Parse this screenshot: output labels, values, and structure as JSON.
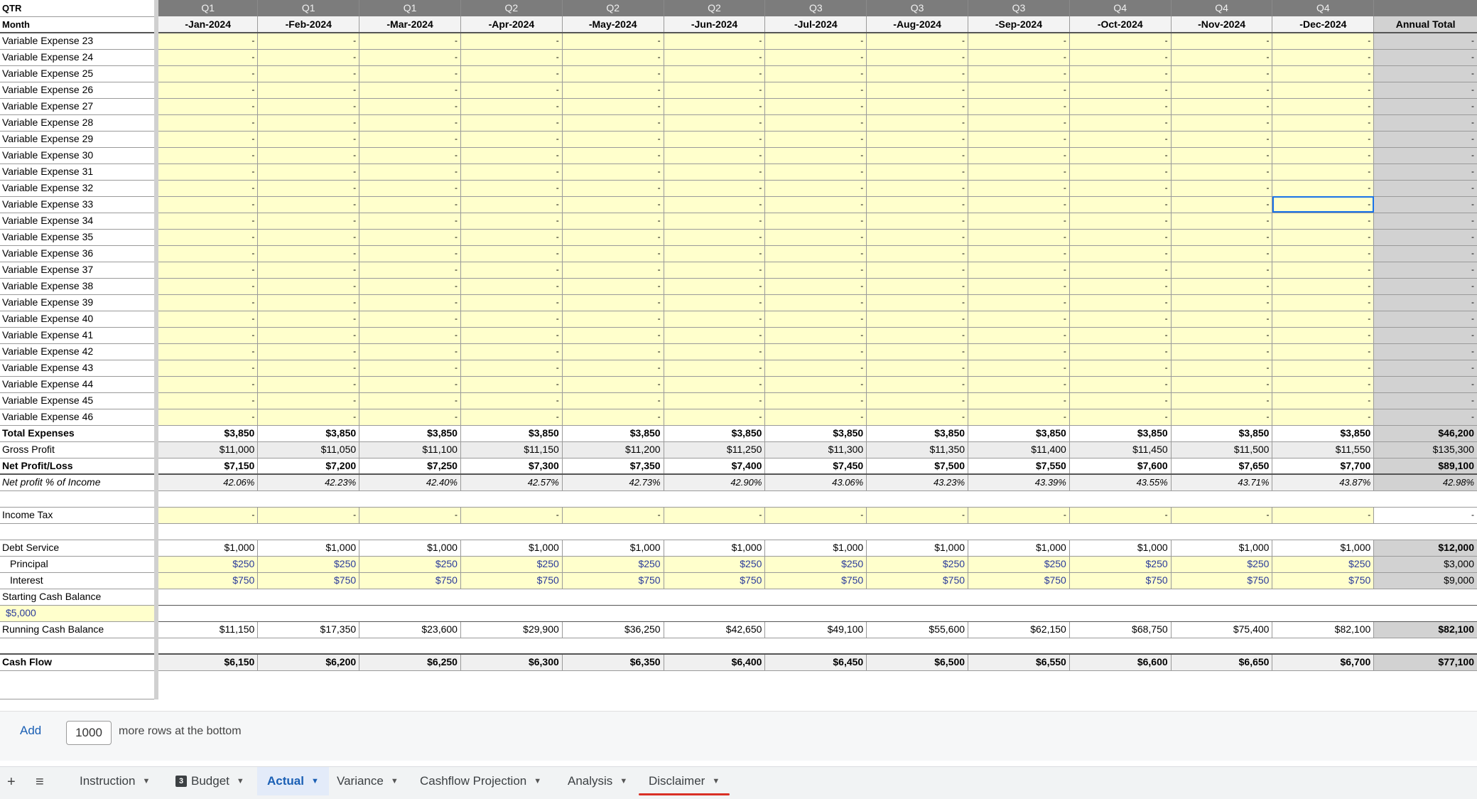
{
  "sheet": {
    "qtr_label": "QTR",
    "month_label": "Month",
    "quarters": [
      "Q1",
      "Q1",
      "Q1",
      "Q2",
      "Q2",
      "Q2",
      "Q3",
      "Q3",
      "Q3",
      "Q4",
      "Q4",
      "Q4"
    ],
    "months": [
      "-Jan-2024",
      "-Feb-2024",
      "-Mar-2024",
      "-Apr-2024",
      "-May-2024",
      "-Jun-2024",
      "-Jul-2024",
      "-Aug-2024",
      "-Sep-2024",
      "-Oct-2024",
      "-Nov-2024",
      "-Dec-2024"
    ],
    "annual_total_label": "Annual Total",
    "empty_value": "-",
    "variable_expenses": [
      "Variable Expense 23",
      "Variable Expense 24",
      "Variable Expense 25",
      "Variable Expense 26",
      "Variable Expense 27",
      "Variable Expense 28",
      "Variable Expense 29",
      "Variable Expense 30",
      "Variable Expense 31",
      "Variable Expense 32",
      "Variable Expense 33",
      "Variable Expense 34",
      "Variable Expense 35",
      "Variable Expense 36",
      "Variable Expense 37",
      "Variable Expense 38",
      "Variable Expense 39",
      "Variable Expense 40",
      "Variable Expense 41",
      "Variable Expense 42",
      "Variable Expense 43",
      "Variable Expense 44",
      "Variable Expense 45",
      "Variable Expense 46"
    ],
    "summary_rows": [
      {
        "label": "Total Expenses",
        "style": "bold",
        "values": [
          "$3,850",
          "$3,850",
          "$3,850",
          "$3,850",
          "$3,850",
          "$3,850",
          "$3,850",
          "$3,850",
          "$3,850",
          "$3,850",
          "$3,850",
          "$3,850"
        ],
        "total": "$46,200"
      },
      {
        "label": "Gross Profit",
        "style": "gray",
        "values": [
          "$11,000",
          "$11,050",
          "$11,100",
          "$11,150",
          "$11,200",
          "$11,250",
          "$11,300",
          "$11,350",
          "$11,400",
          "$11,450",
          "$11,500",
          "$11,550"
        ],
        "total": "$135,300"
      },
      {
        "label": "Net Profit/Loss",
        "style": "bold",
        "values": [
          "$7,150",
          "$7,200",
          "$7,250",
          "$7,300",
          "$7,350",
          "$7,400",
          "$7,450",
          "$7,500",
          "$7,550",
          "$7,600",
          "$7,650",
          "$7,700"
        ],
        "total": "$89,100"
      }
    ],
    "net_profit_pct": {
      "label": "Net profit % of Income",
      "values": [
        "42.06%",
        "42.23%",
        "42.40%",
        "42.57%",
        "42.73%",
        "42.90%",
        "43.06%",
        "43.23%",
        "43.39%",
        "43.55%",
        "43.71%",
        "43.87%"
      ],
      "total": "42.98%"
    },
    "income_tax": {
      "label": "Income Tax"
    },
    "debt_service": {
      "label": "Debt Service",
      "values": [
        "$1,000",
        "$1,000",
        "$1,000",
        "$1,000",
        "$1,000",
        "$1,000",
        "$1,000",
        "$1,000",
        "$1,000",
        "$1,000",
        "$1,000",
        "$1,000"
      ],
      "total": "$12,000"
    },
    "principal": {
      "label": "Principal",
      "values": [
        "$250",
        "$250",
        "$250",
        "$250",
        "$250",
        "$250",
        "$250",
        "$250",
        "$250",
        "$250",
        "$250",
        "$250"
      ],
      "total": "$3,000"
    },
    "interest": {
      "label": "Interest",
      "values": [
        "$750",
        "$750",
        "$750",
        "$750",
        "$750",
        "$750",
        "$750",
        "$750",
        "$750",
        "$750",
        "$750",
        "$750"
      ],
      "total": "$9,000"
    },
    "starting_cash": {
      "label": "Starting Cash Balance",
      "value": "$5,000"
    },
    "running_cash": {
      "label": "Running Cash Balance",
      "values": [
        "$11,150",
        "$17,350",
        "$23,600",
        "$29,900",
        "$36,250",
        "$42,650",
        "$49,100",
        "$55,600",
        "$62,150",
        "$68,750",
        "$75,400",
        "$82,100"
      ],
      "total": "$82,100"
    },
    "cash_flow": {
      "label": "Cash Flow",
      "values": [
        "$6,150",
        "$6,200",
        "$6,250",
        "$6,300",
        "$6,350",
        "$6,400",
        "$6,450",
        "$6,500",
        "$6,550",
        "$6,600",
        "$6,650",
        "$6,700"
      ],
      "total": "$77,100"
    },
    "selected_cell": {
      "row": "Variable Expense 33",
      "column": "-Dec-2024"
    }
  },
  "add_rows": {
    "button": "Add",
    "count": "1000",
    "suffix": "more rows at the bottom"
  },
  "tabbar": {
    "add_sheet_icon": "+",
    "all_sheets_icon": "≡",
    "tabs": [
      {
        "label": "Instruction",
        "active": false
      },
      {
        "label": "Budget",
        "active": false,
        "badge": "3"
      },
      {
        "label": "Actual",
        "active": true
      },
      {
        "label": "Variance",
        "active": false
      },
      {
        "label": "Cashflow Projection",
        "active": false
      },
      {
        "label": "Analysis",
        "active": false
      },
      {
        "label": "Disclaimer",
        "active": false,
        "underline": true
      }
    ]
  },
  "colors": {
    "input_cell": "#ffffcc",
    "header_bar": "#7c7c7c",
    "total_column": "#d2d2d2",
    "blue_text": "#2a3a9a",
    "active_tab": "#1a5fb4",
    "tab_underline": "#d93025"
  }
}
